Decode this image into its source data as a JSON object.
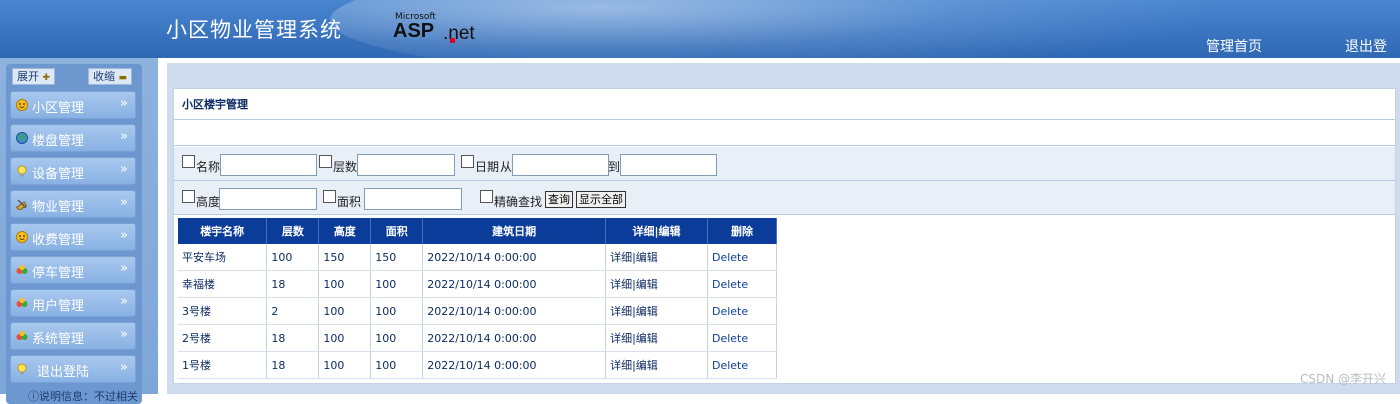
{
  "header": {
    "title": "小区物业管理系统",
    "logo": {
      "vendor": "Microsoft",
      "product": "ASP",
      "suffix": ".net"
    },
    "links": [
      "管理首页",
      "退出登陆"
    ]
  },
  "sidebar": {
    "expand_label": "展开",
    "collapse_label": "收缩",
    "arrow": "»",
    "items": [
      {
        "label": "小区管理",
        "icon": "smiley-icon"
      },
      {
        "label": "楼盘管理",
        "icon": "globe-icon"
      },
      {
        "label": "设备管理",
        "icon": "bulb-icon"
      },
      {
        "label": "物业管理",
        "icon": "tools-icon"
      },
      {
        "label": "收费管理",
        "icon": "smiley-icon"
      },
      {
        "label": "停车管理",
        "icon": "users-icon"
      },
      {
        "label": "用户管理",
        "icon": "users-icon"
      },
      {
        "label": "系统管理",
        "icon": "users-icon"
      },
      {
        "label": "退出登陆",
        "icon": "bulb-icon"
      }
    ],
    "footer": "ⓘ说明信息：不过相关"
  },
  "main": {
    "section_title": "小区楼宇管理",
    "filters": {
      "name": "名称",
      "floors": "层数",
      "date": "日期",
      "from": "从",
      "to": "到",
      "height": "高度",
      "area": "面积",
      "exact": "精确查找",
      "query_button": "查询",
      "show_all_button": "显示全部"
    },
    "table": {
      "headers": [
        "楼宇名称",
        "层数",
        "高度",
        "面积",
        "建筑日期",
        "详细|编辑",
        "删除"
      ],
      "rows": [
        [
          "平安车场",
          "100",
          "150",
          "150",
          "2022/10/14 0:00:00",
          "详细|编辑",
          "Delete"
        ],
        [
          "幸福楼",
          "18",
          "100",
          "100",
          "2022/10/14 0:00:00",
          "详细|编辑",
          "Delete"
        ],
        [
          "3号楼",
          "2",
          "100",
          "100",
          "2022/10/14 0:00:00",
          "详细|编辑",
          "Delete"
        ],
        [
          "2号楼",
          "18",
          "100",
          "100",
          "2022/10/14 0:00:00",
          "详细|编辑",
          "Delete"
        ],
        [
          "1号楼",
          "18",
          "100",
          "100",
          "2022/10/14 0:00:00",
          "详细|编辑",
          "Delete"
        ]
      ]
    }
  },
  "watermark": "CSDN @李开兴"
}
